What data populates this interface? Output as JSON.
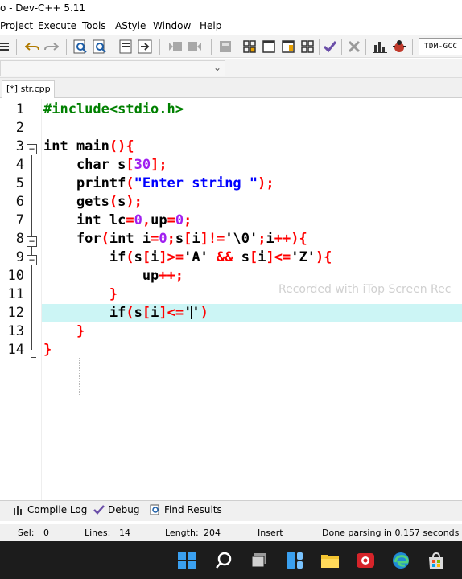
{
  "window": {
    "title": "o - Dev-C++ 5.11"
  },
  "menu": [
    "Project",
    "Execute",
    "Tools",
    "AStyle",
    "Window",
    "Help"
  ],
  "toolbar": {
    "compiler_label": "TDM-GCC",
    "icons": [
      "indent-icon",
      "undo-icon",
      "redo-icon",
      "find-icon",
      "replace-icon",
      "bookmark-icon",
      "goto-icon",
      "back-icon",
      "forward-icon",
      "grid-icon",
      "window-icon",
      "layout-icon",
      "tile-icon",
      "check-icon",
      "delete-icon",
      "chart-icon",
      "debug-icon"
    ]
  },
  "tab": {
    "label": "[*] str.cpp"
  },
  "editor": {
    "current_line": 12,
    "lines": [
      {
        "n": "1",
        "tokens": [
          {
            "t": "#include<stdio.h>",
            "c": "pre"
          }
        ]
      },
      {
        "n": "2",
        "tokens": []
      },
      {
        "n": "3",
        "tokens": [
          {
            "t": "int main",
            "c": "k"
          },
          {
            "t": "(){",
            "c": "sym"
          }
        ]
      },
      {
        "n": "4",
        "tokens": [
          {
            "t": "    char s",
            "c": "k"
          },
          {
            "t": "[",
            "c": "sym"
          },
          {
            "t": "30",
            "c": "num"
          },
          {
            "t": "];",
            "c": "sym"
          }
        ]
      },
      {
        "n": "5",
        "tokens": [
          {
            "t": "    printf",
            "c": "k"
          },
          {
            "t": "(",
            "c": "sym"
          },
          {
            "t": "\"Enter string \"",
            "c": "str"
          },
          {
            "t": ");",
            "c": "sym"
          }
        ]
      },
      {
        "n": "6",
        "tokens": [
          {
            "t": "    gets",
            "c": "k"
          },
          {
            "t": "(",
            "c": "sym"
          },
          {
            "t": "s",
            "c": "k"
          },
          {
            "t": ");",
            "c": "sym"
          }
        ]
      },
      {
        "n": "7",
        "tokens": [
          {
            "t": "    int lc",
            "c": "k"
          },
          {
            "t": "=",
            "c": "sym"
          },
          {
            "t": "0",
            "c": "num"
          },
          {
            "t": ",",
            "c": "sym"
          },
          {
            "t": "up",
            "c": "k"
          },
          {
            "t": "=",
            "c": "sym"
          },
          {
            "t": "0",
            "c": "num"
          },
          {
            "t": ";",
            "c": "sym"
          }
        ]
      },
      {
        "n": "8",
        "tokens": [
          {
            "t": "    for",
            "c": "k"
          },
          {
            "t": "(",
            "c": "sym"
          },
          {
            "t": "int i",
            "c": "k"
          },
          {
            "t": "=",
            "c": "sym"
          },
          {
            "t": "0",
            "c": "num"
          },
          {
            "t": ";",
            "c": "sym"
          },
          {
            "t": "s",
            "c": "k"
          },
          {
            "t": "[",
            "c": "sym"
          },
          {
            "t": "i",
            "c": "k"
          },
          {
            "t": "]!=",
            "c": "sym"
          },
          {
            "t": "'\\0'",
            "c": "k"
          },
          {
            "t": ";",
            "c": "sym"
          },
          {
            "t": "i",
            "c": "k"
          },
          {
            "t": "++){",
            "c": "sym"
          }
        ]
      },
      {
        "n": "9",
        "tokens": [
          {
            "t": "        if",
            "c": "k"
          },
          {
            "t": "(",
            "c": "sym"
          },
          {
            "t": "s",
            "c": "k"
          },
          {
            "t": "[",
            "c": "sym"
          },
          {
            "t": "i",
            "c": "k"
          },
          {
            "t": "]>=",
            "c": "sym"
          },
          {
            "t": "'A'",
            "c": "k"
          },
          {
            "t": " && ",
            "c": "sym"
          },
          {
            "t": "s",
            "c": "k"
          },
          {
            "t": "[",
            "c": "sym"
          },
          {
            "t": "i",
            "c": "k"
          },
          {
            "t": "]<=",
            "c": "sym"
          },
          {
            "t": "'Z'",
            "c": "k"
          },
          {
            "t": "){",
            "c": "sym"
          }
        ]
      },
      {
        "n": "10",
        "tokens": [
          {
            "t": "            up",
            "c": "k"
          },
          {
            "t": "++;",
            "c": "sym"
          }
        ]
      },
      {
        "n": "11",
        "tokens": [
          {
            "t": "        ",
            "c": "k"
          },
          {
            "t": "}",
            "c": "sym"
          }
        ]
      },
      {
        "n": "12",
        "tokens": [
          {
            "t": "        if",
            "c": "k"
          },
          {
            "t": "(",
            "c": "sym"
          },
          {
            "t": "s",
            "c": "k"
          },
          {
            "t": "[",
            "c": "sym"
          },
          {
            "t": "i",
            "c": "k"
          },
          {
            "t": "]<=",
            "c": "sym"
          },
          {
            "t": "'",
            "c": "k"
          },
          {
            "t": "|CURSOR|",
            "c": "cursor"
          },
          {
            "t": "'",
            "c": "k"
          },
          {
            "t": ")",
            "c": "sym"
          }
        ]
      },
      {
        "n": "13",
        "tokens": [
          {
            "t": "    ",
            "c": "k"
          },
          {
            "t": "}",
            "c": "sym"
          }
        ]
      },
      {
        "n": "14",
        "tokens": [
          {
            "t": "}",
            "c": "sym"
          }
        ]
      }
    ]
  },
  "watermark": "Recorded with iTop Screen Rec",
  "bottom_tabs": [
    {
      "label": "Compile Log",
      "icon": "chart-icon"
    },
    {
      "label": "Debug",
      "icon": "check-icon"
    },
    {
      "label": "Find Results",
      "icon": "find-icon"
    }
  ],
  "status": {
    "sel_label": "Sel:",
    "sel_value": "0",
    "lines_label": "Lines:",
    "lines_value": "14",
    "length_label": "Length:",
    "length_value": "204",
    "mode": "Insert",
    "message": "Done parsing in 0.157 seconds"
  },
  "taskbar": [
    "windows-start-icon",
    "search-icon",
    "task-view-icon",
    "widgets-icon",
    "file-explorer-icon",
    "screen-recorder-icon",
    "edge-icon",
    "store-icon"
  ]
}
